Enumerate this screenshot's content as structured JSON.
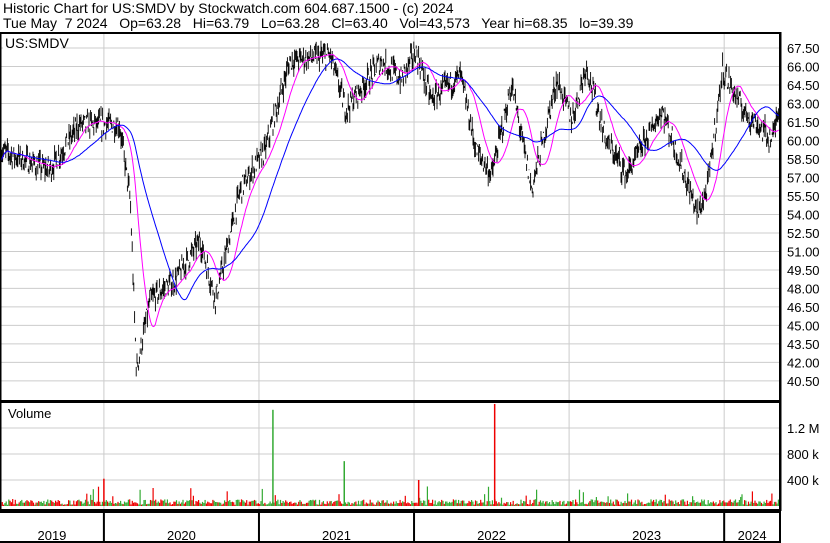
{
  "header": {
    "title": "Historic Chart for US:SMDV by Stockwatch.com 604.687.1500 - (c) 2024",
    "quote": "Tue May  7 2024   Op=63.28   Hi=63.79   Lo=63.28   Cl=63.40   Vol=43,573   Year hi=68.35   lo=39.39"
  },
  "chart_data": [
    {
      "type": "line",
      "title": "US:SMDV",
      "subtype": "ohlc-bars with moving averages",
      "ylim": [
        39.4,
        68.7
      ],
      "yticks": [
        "67.50",
        "66.00",
        "64.50",
        "63.00",
        "61.50",
        "60.00",
        "58.50",
        "57.00",
        "55.50",
        "54.00",
        "52.50",
        "51.00",
        "49.50",
        "48.00",
        "46.50",
        "45.00",
        "43.50",
        "42.00",
        "40.50"
      ],
      "x_range": [
        2019.33,
        2024.36
      ],
      "x_labels": [
        "2019",
        "2020",
        "2021",
        "2022",
        "2023",
        "2024"
      ],
      "series": [
        {
          "name": "price (approx. path, year → price)",
          "points": [
            [
              2019.33,
              59.2
            ],
            [
              2019.65,
              57.6
            ],
            [
              2019.84,
              61.3
            ],
            [
              2020.1,
              61.3
            ],
            [
              2020.17,
              55.2
            ],
            [
              2020.21,
              41.4
            ],
            [
              2020.3,
              47.1
            ],
            [
              2020.46,
              48.7
            ],
            [
              2020.62,
              51.9
            ],
            [
              2020.72,
              47.1
            ],
            [
              2020.88,
              56.0
            ],
            [
              2021.04,
              59.2
            ],
            [
              2021.2,
              66.5
            ],
            [
              2021.46,
              66.9
            ],
            [
              2021.56,
              62.5
            ],
            [
              2021.79,
              66.5
            ],
            [
              2021.92,
              64.9
            ],
            [
              2022.01,
              67.3
            ],
            [
              2022.11,
              63.3
            ],
            [
              2022.3,
              65.3
            ],
            [
              2022.4,
              59.2
            ],
            [
              2022.5,
              57.2
            ],
            [
              2022.63,
              64.5
            ],
            [
              2022.76,
              56.0
            ],
            [
              2022.92,
              64.9
            ],
            [
              2023.02,
              61.7
            ],
            [
              2023.11,
              66.1
            ],
            [
              2023.24,
              60.0
            ],
            [
              2023.37,
              57.2
            ],
            [
              2023.6,
              62.5
            ],
            [
              2023.83,
              54.0
            ],
            [
              2023.89,
              56.0
            ],
            [
              2023.99,
              65.7
            ],
            [
              2024.12,
              62.5
            ],
            [
              2024.31,
              60.0
            ],
            [
              2024.36,
              63.4
            ]
          ]
        },
        {
          "name": "short moving average",
          "color": "#ff00ff"
        },
        {
          "name": "long moving average",
          "color": "#0000ff"
        }
      ]
    },
    {
      "type": "bar",
      "title": "Volume",
      "yticks": [
        "1.2 M",
        "800 k",
        "400 k"
      ],
      "ylim": [
        0,
        1650000
      ],
      "typical_volume": 60000,
      "spikes": [
        {
          "x": 2021.09,
          "value": 1480000,
          "color": "green"
        },
        {
          "x": 2021.55,
          "value": 690000,
          "color": "green"
        },
        {
          "x": 2022.03,
          "value": 400000,
          "color": "red"
        },
        {
          "x": 2022.52,
          "value": 1570000,
          "color": "red"
        },
        {
          "x": 2020.0,
          "value": 420000,
          "color": "red"
        }
      ]
    }
  ]
}
